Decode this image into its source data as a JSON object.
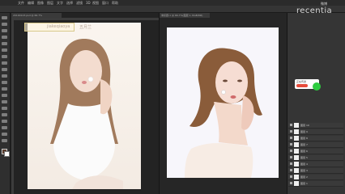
{
  "menubar": {
    "items": [
      "文件",
      "编辑",
      "图像",
      "图层",
      "文字",
      "选择",
      "滤镜",
      "3D",
      "视图",
      "窗口",
      "帮助"
    ]
  },
  "doc1": {
    "tab": "20190123.psd @ 66.7%"
  },
  "doc2": {
    "tab": "未标题-1 @ 66.7%(图层 1, RGB/8#)"
  },
  "canvas_text": {
    "left": "jiakeqiaoya",
    "right": "五月兰"
  },
  "watermark": {
    "brand": "recentia",
    "cn": "微博"
  },
  "toast": {
    "title": "正在传送"
  },
  "layers": [
    {
      "name": "图层 10"
    },
    {
      "name": "图层 9"
    },
    {
      "name": "图层 8"
    },
    {
      "name": "图层 7"
    },
    {
      "name": "图层 6"
    },
    {
      "name": "图层 5"
    },
    {
      "name": "图层 4"
    },
    {
      "name": "图层 3"
    },
    {
      "name": "图层 2"
    },
    {
      "name": "图层 1"
    }
  ],
  "colors": {
    "accent_green": "#2ecc40",
    "accent_red": "#e74c3c"
  }
}
